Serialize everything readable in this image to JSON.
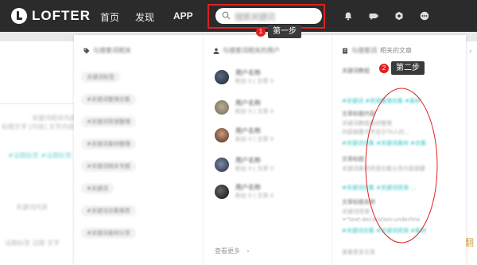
{
  "app": {
    "logo_text": "LOFTER"
  },
  "nav": {
    "home": "首页",
    "discover": "发现",
    "app": "APP"
  },
  "search": {
    "value": "搜索关键词",
    "icon": "search-icon"
  },
  "header_icons": [
    "bell-icon",
    "chat-icon",
    "gear-icon",
    "more-icon"
  ],
  "annotations": {
    "step1_number": "1",
    "step1_label": "第一步",
    "step2_number": "2",
    "step2_label": "第二步",
    "highlight_color": "#e02020"
  },
  "dropdown": {
    "tags_header": "与搜索词相关",
    "tags": [
      "关键词标签",
      "#关键词整理合集",
      "#关键词资源整理",
      "#关键词素材整理",
      "#关键词相关专题",
      "#关键词",
      "#关键词合集推荐",
      "#关键词素材分享"
    ],
    "users_header": "与搜索词相关的用户",
    "users": [
      {
        "name": "用户名称",
        "meta": "粉丝 0 | 文章 0"
      },
      {
        "name": "用户名称",
        "meta": "粉丝 0 | 文章 0"
      },
      {
        "name": "用户名称",
        "meta": "粉丝 0 | 文章 0"
      },
      {
        "name": "用户名称",
        "meta": "粉丝 0 | 文章 0"
      },
      {
        "name": "用户名称",
        "meta": "粉丝 0 | 文章 0"
      }
    ],
    "see_more": "查看更多",
    "articles_header_blur": "与搜索词",
    "articles_header_plain": "相关的文章",
    "articles": [
      {
        "title": "关键词教程",
        "tags": "#关键词  #资源整理合集  #素材"
      },
      {
        "title": "文章标题内容",
        "body": "关键词教程素材整理",
        "extra": "内容摘要文字显示TA人的...",
        "tags": "#关键词合集  #关键词素材  #合集"
      },
      {
        "title": "文章标题",
        "body": "关键词素材资源合集分享内容摘要",
        "tags": "#关键词合集  #关键词资源  ..."
      },
      {
        "title": "文章标题名称",
        "body": "关键词资源",
        "extra": "=\"text-decoration:underline",
        "tags": "#关键词合集  #关键词资源  #素材"
      }
    ],
    "footer_blur": "查看更多文章"
  },
  "background": {
    "left_lines": [
      "关键词相关内容文字",
      "标题文字 [内容] 文字内容",
      "#话题标签 #话题标签",
      "关键词内容",
      "话题标签 话题 文字"
    ],
    "right_glyph": "›",
    "bottom_right_text": "翻"
  }
}
